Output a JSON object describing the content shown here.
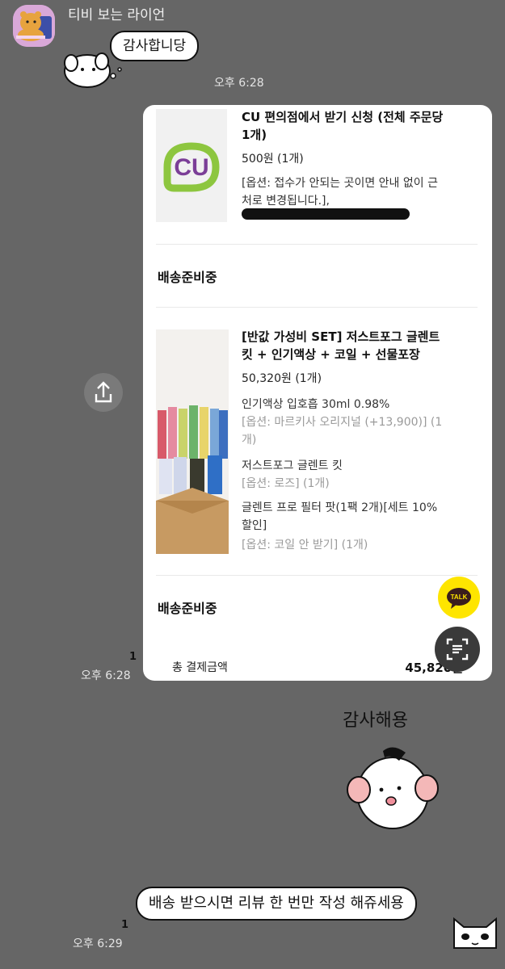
{
  "chat": {
    "sender_name": "티비 보는 라이언",
    "sticker_message_1": "감사합니당",
    "time_1": "오후 6:28",
    "time_2": "오후 6:28",
    "read_count_2": "1",
    "sticker_message_2": "감사해용",
    "bubble_message": "배송 받으시면 리뷰 한 번만 작성 해쥬세용",
    "time_3": "오후 6:29",
    "read_count_3": "1"
  },
  "order_card": {
    "item1": {
      "logo_text": "CU",
      "title_line1": "CU 편의점에서 받기 신청 (전체 주문당",
      "title_line2": "1개)",
      "price": "500원 (1개)",
      "option_line1": "[옵션: 접수가 안되는 곳이면 안내 없이 근",
      "option_line2": "처로 변경됩니다.],"
    },
    "status_1": "배송준비중",
    "item2": {
      "title_line1": "[반값 가성비 SET] 저스트포그 글렌트",
      "title_line2": "킷 + 인기액상 + 코일 + 선물포장",
      "price": "50,320원 (1개)",
      "sub1_name": "인기액상 입호흡 30ml 0.98%",
      "sub1_opt_line1": "[옵션: 마르키사 오리지널 (+13,900)] (1",
      "sub1_opt_line2": "개)",
      "sub2_name": "저스트포그 글렌트 킷",
      "sub2_opt": "[옵션: 로즈] (1개)",
      "sub3_name_line1": "글렌트 프로 필터 팟(1팩 2개)[세트 10%",
      "sub3_name_line2": "할인]",
      "sub3_opt": "[옵션: 코일 안 받기] (1개)"
    },
    "status_2": "배송준비중",
    "total_label": "총 결제금액",
    "total_value": "45,820원"
  },
  "buttons": {
    "talk_label": "TALK"
  },
  "colors": {
    "background": "#666666",
    "cu_purple": "#7b3e97",
    "cu_green": "#8dc63f",
    "talk_yellow": "#fee500"
  }
}
